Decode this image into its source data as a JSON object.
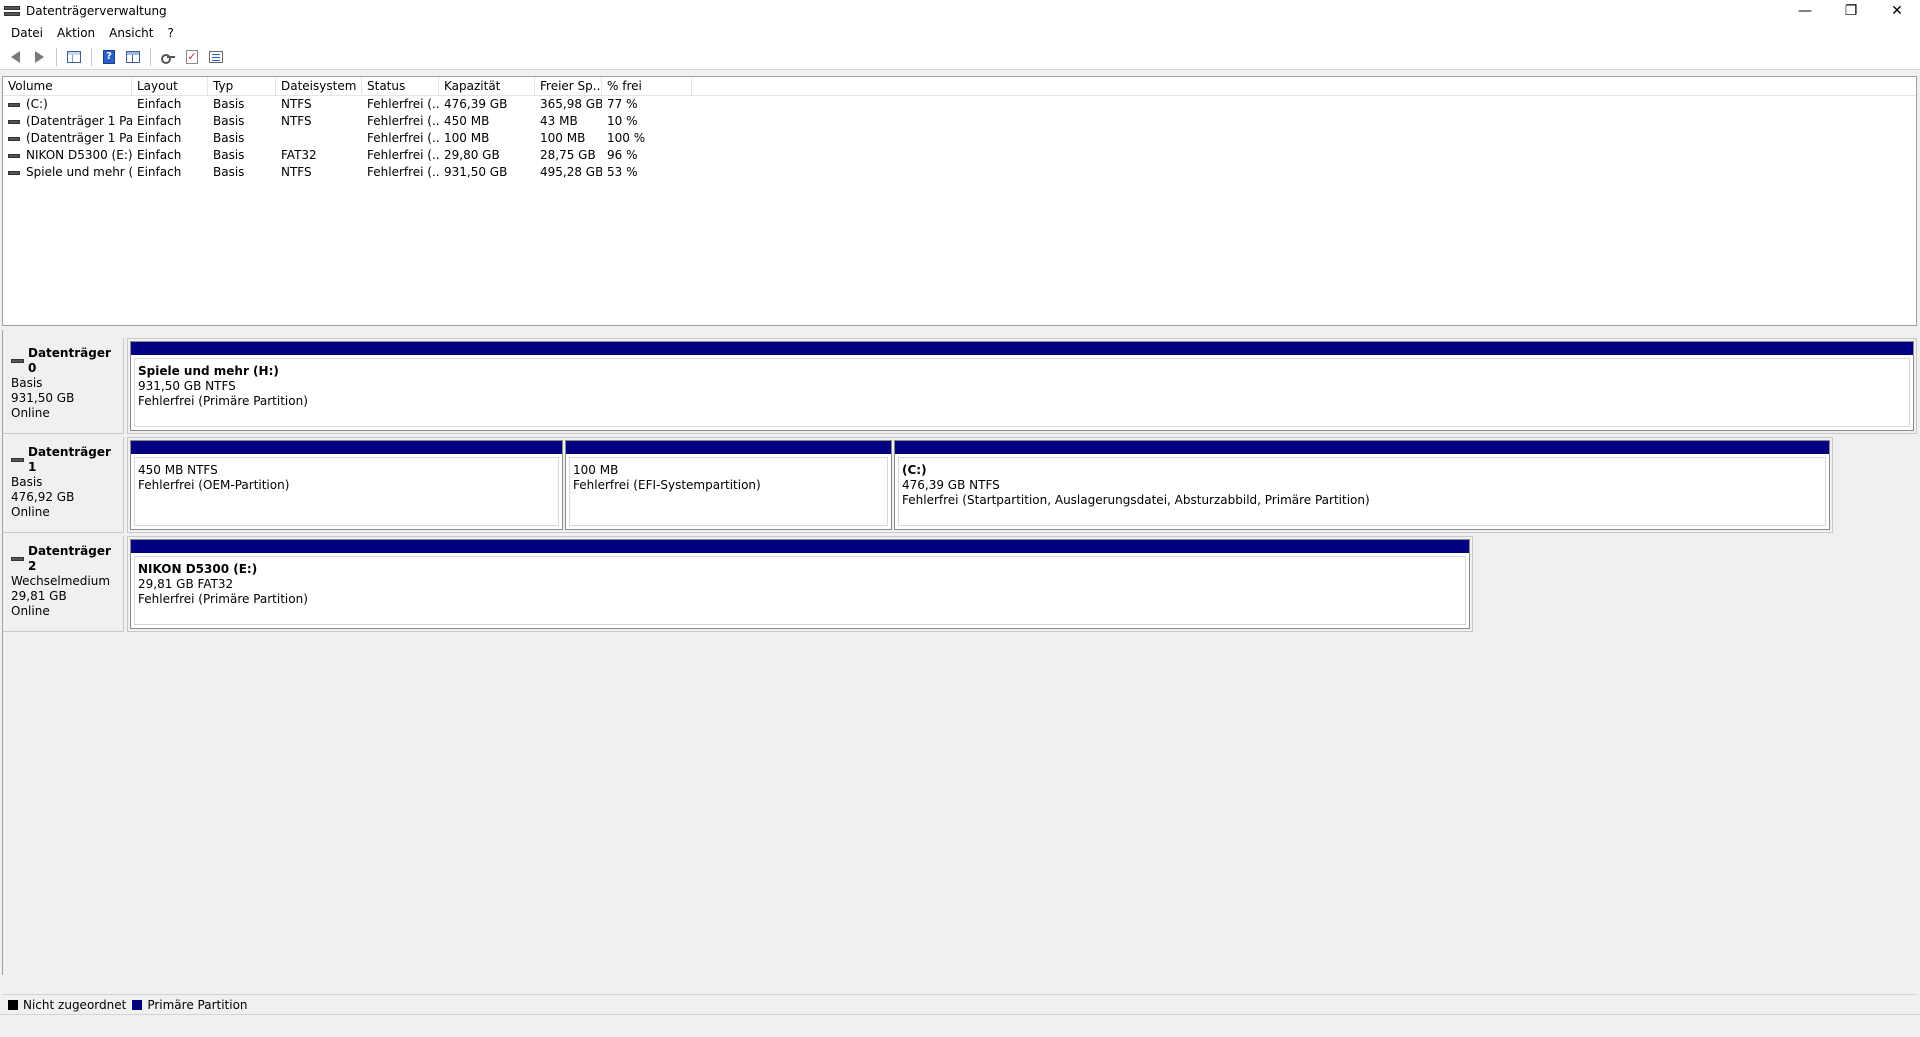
{
  "window": {
    "title": "Datenträgerverwaltung",
    "minimize": "—",
    "restore": "❐",
    "close": "✕"
  },
  "menu": [
    "Datei",
    "Aktion",
    "Ansicht",
    "?"
  ],
  "toolbar": {
    "icons": [
      "back-icon",
      "forward-icon",
      "console-tree-icon",
      "help-icon",
      "show-pane-icon",
      "rescan-icon",
      "check-icon",
      "properties-icon"
    ],
    "help_glyph": "?",
    "check_glyph": "✓"
  },
  "volume_list": {
    "columns": [
      "Volume",
      "Layout",
      "Typ",
      "Dateisystem",
      "Status",
      "Kapazität",
      "Freier Sp...",
      "% frei"
    ],
    "rows": [
      {
        "volume": "(C:)",
        "layout": "Einfach",
        "typ": "Basis",
        "fs": "NTFS",
        "status": "Fehlerfrei (...",
        "kapazitaet": "476,39 GB",
        "frei": "365,98 GB",
        "prozent": "77 %"
      },
      {
        "volume": "(Datenträger 1 Par...",
        "layout": "Einfach",
        "typ": "Basis",
        "fs": "NTFS",
        "status": "Fehlerfrei (...",
        "kapazitaet": "450 MB",
        "frei": "43 MB",
        "prozent": "10 %"
      },
      {
        "volume": "(Datenträger 1 Par...",
        "layout": "Einfach",
        "typ": "Basis",
        "fs": "",
        "status": "Fehlerfrei (...",
        "kapazitaet": "100 MB",
        "frei": "100 MB",
        "prozent": "100 %"
      },
      {
        "volume": "NIKON D5300 (E:)",
        "layout": "Einfach",
        "typ": "Basis",
        "fs": "FAT32",
        "status": "Fehlerfrei (...",
        "kapazitaet": "29,80 GB",
        "frei": "28,75 GB",
        "prozent": "96 %"
      },
      {
        "volume": "Spiele und mehr (...",
        "layout": "Einfach",
        "typ": "Basis",
        "fs": "NTFS",
        "status": "Fehlerfrei (...",
        "kapazitaet": "931,50 GB",
        "frei": "495,28 GB",
        "prozent": "53 %"
      }
    ]
  },
  "disks": [
    {
      "name": "Datenträger 0",
      "type": "Basis",
      "size": "931,50 GB",
      "state": "Online",
      "partitions": [
        {
          "name": "Spiele und mehr  (H:)",
          "size": "931,50 GB NTFS",
          "status": "Fehlerfrei (Primäre Partition)"
        }
      ]
    },
    {
      "name": "Datenträger 1",
      "type": "Basis",
      "size": "476,92 GB",
      "state": "Online",
      "partitions": [
        {
          "name": "",
          "size": "450 MB NTFS",
          "status": "Fehlerfrei (OEM-Partition)"
        },
        {
          "name": "",
          "size": "100 MB",
          "status": "Fehlerfrei (EFI-Systempartition)"
        },
        {
          "name": "(C:)",
          "size": "476,39 GB NTFS",
          "status": "Fehlerfrei (Startpartition, Auslagerungsdatei, Absturzabbild, Primäre Partition)"
        }
      ]
    },
    {
      "name": "Datenträger 2",
      "type": "Wechselmedium",
      "size": "29,81 GB",
      "state": "Online",
      "partitions": [
        {
          "name": "NIKON D5300  (E:)",
          "size": "29,81 GB FAT32",
          "status": "Fehlerfrei (Primäre Partition)"
        }
      ]
    }
  ],
  "legend": [
    {
      "label": "Nicht zugeordnet",
      "color": "#000000"
    },
    {
      "label": "Primäre Partition",
      "color": "#000080"
    }
  ],
  "colors": {
    "primary_partition_bar": "#000080"
  }
}
